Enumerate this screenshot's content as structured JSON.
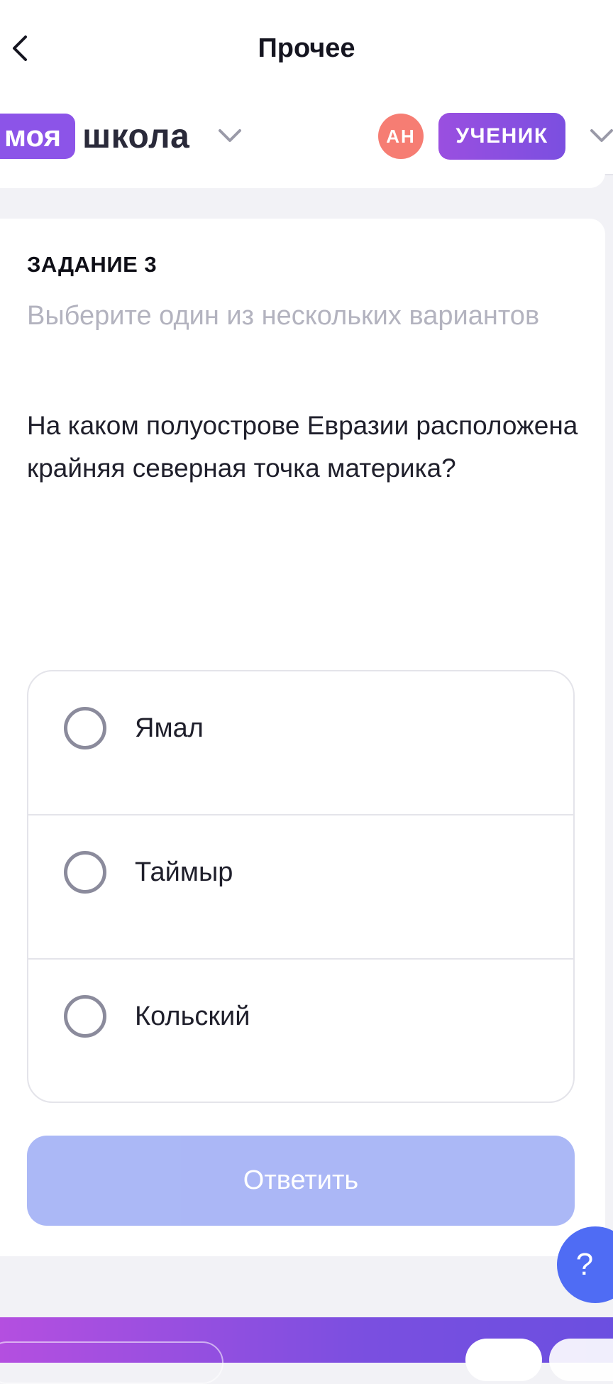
{
  "header": {
    "title": "Прочее",
    "back_icon": "chevron-left-icon"
  },
  "brand": {
    "badge": "моя",
    "text": "школа"
  },
  "user": {
    "initials": "АН",
    "role": "УЧЕНИК"
  },
  "task": {
    "label": "ЗАДАНИЕ 3",
    "hint": "Выберите один из нескольких вариантов",
    "question": "На каком полуострове Евразии расположена крайняя северная точка материка?",
    "options": [
      {
        "label": "Ямал"
      },
      {
        "label": "Таймыр"
      },
      {
        "label": "Кольский"
      }
    ],
    "submit_label": "Ответить"
  },
  "help": {
    "label": "?"
  },
  "colors": {
    "brand": "#8c54e8",
    "avatar": "#f67d73",
    "submit_disabled": "#a7b4f6",
    "help": "#4f6cf4"
  }
}
